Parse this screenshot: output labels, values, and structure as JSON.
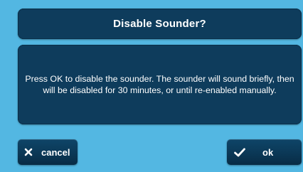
{
  "dialog": {
    "title": "Disable Sounder?",
    "message": "Press OK to disable the sounder. The sounder will sound briefly, then will be disabled for 30 minutes, or until re-enabled manually."
  },
  "buttons": {
    "cancel_label": "cancel",
    "cancel_icon": "close-icon",
    "ok_label": "ok",
    "ok_icon": "checkmark-icon"
  },
  "colors": {
    "background": "#53b7e2",
    "panel": "#0e3c5c",
    "text": "#ffffff"
  }
}
